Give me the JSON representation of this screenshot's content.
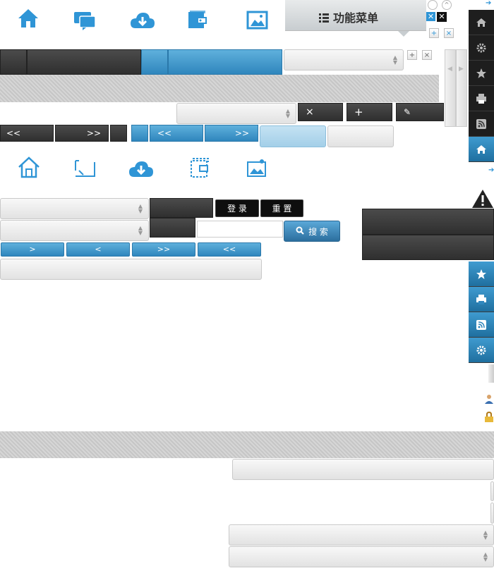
{
  "menu_title": "功能菜单",
  "login": "登 录",
  "reset": "重 置",
  "search": "搜 索",
  "nav": {
    "first": "<<",
    "last": ">>",
    "prev": "<",
    "next": ">"
  },
  "side_icons": {
    "home": "home-icon",
    "settings": "gear-icon",
    "favorite": "star-icon",
    "print": "printer-icon",
    "rss": "rss-icon",
    "warning": "warning-icon",
    "user": "user-icon",
    "lock": "lock-icon"
  },
  "colors": {
    "accent": "#2f86bd",
    "dark": "#2f2f2f"
  }
}
